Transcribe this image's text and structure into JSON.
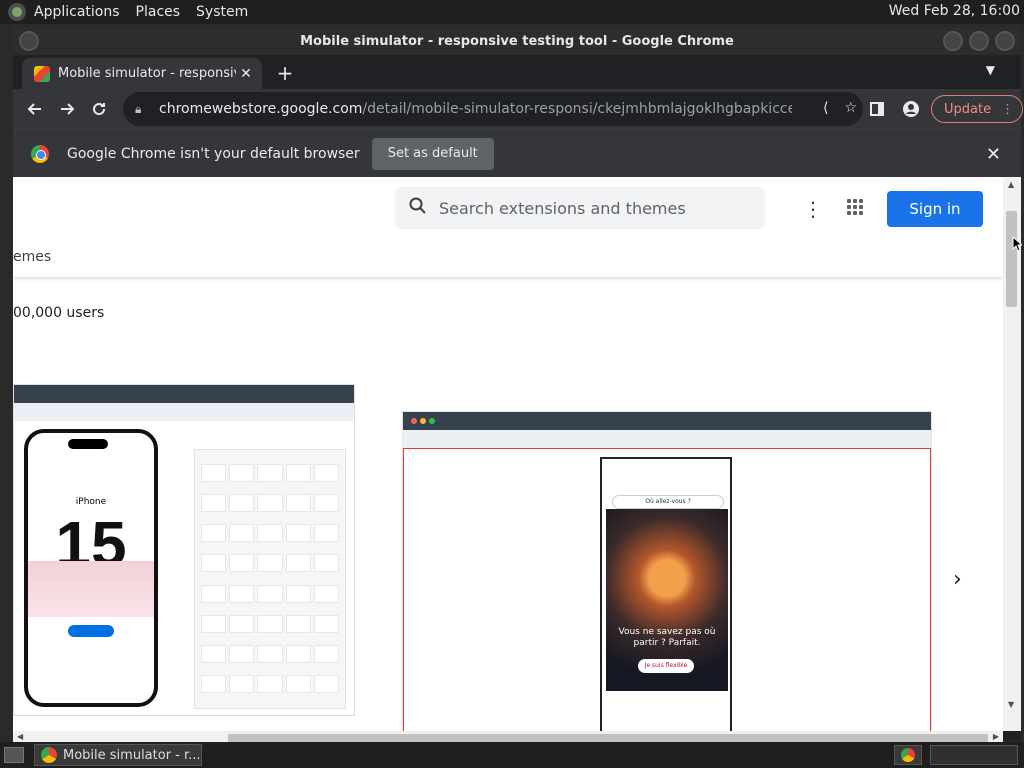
{
  "desktop": {
    "menus": [
      "Applications",
      "Places",
      "System"
    ],
    "clock": "Wed Feb 28, 16:00"
  },
  "window": {
    "title": "Mobile simulator - responsive testing tool - Google Chrome"
  },
  "tabs": [
    {
      "title": "Mobile simulator - responsive testing tool"
    }
  ],
  "toolbar": {
    "url_host": "chromewebstore.google.com",
    "url_path": "/detail/mobile-simulator-responsi/ckejmhbmlajgoklhgbapkiccekfoccmk",
    "update_label": "Update"
  },
  "infobar": {
    "message": "Google Chrome isn't your default browser",
    "set_default_label": "Set as default"
  },
  "page": {
    "search_placeholder": "Search extensions and themes",
    "sign_in_label": "Sign in",
    "breadcrumb_fragment": "emes",
    "users_fragment": "00,000 users",
    "screenshot1": {
      "phone_title": "iPhone",
      "big_number": "15"
    },
    "screenshot2": {
      "search_pill": "Où allez-vous ?",
      "headline": "Vous ne savez pas où partir ? Parfait.",
      "cta": "Je suis flexible"
    }
  },
  "taskbar": {
    "window_item": "Mobile simulator - r..."
  },
  "colors": {
    "accent_blue": "#1a73e8",
    "update_red": "#f28b82",
    "frame_red": "#e53935"
  }
}
